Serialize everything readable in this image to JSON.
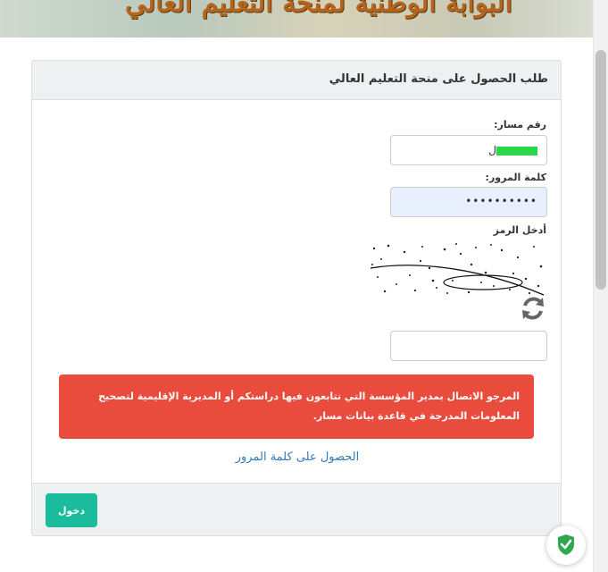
{
  "banner": {
    "title": "البوابة الوطنية لمنحة التعليم العالي"
  },
  "form": {
    "title": "طلب الحصول على منحة التعليم العالي",
    "username_label": "رقم مسار:",
    "username_value_visible": "ل",
    "password_label": "كلمة المرور:",
    "password_value": "••••••••••",
    "captcha_label": "أدخل الرمز",
    "captcha_text": "TUR8",
    "captcha_input_value": ""
  },
  "alert": {
    "message": "المرجو الاتصال بمدير المؤسسة التي تتابعون فيها دراستكم أو المديرية الإقليمية لتصحيح المعلومات المدرجة في قاعدة بيانات مسار."
  },
  "links": {
    "get_password": "الحصول على كلمة المرور"
  },
  "footer": {
    "login_label": "دخول"
  },
  "icons": {
    "refresh": "refresh-icon",
    "shield": "shield-check-icon"
  },
  "colors": {
    "accent": "#1abc9c",
    "alert": "#e94b3c",
    "link": "#337ab7",
    "mask": "#2bd64a"
  }
}
